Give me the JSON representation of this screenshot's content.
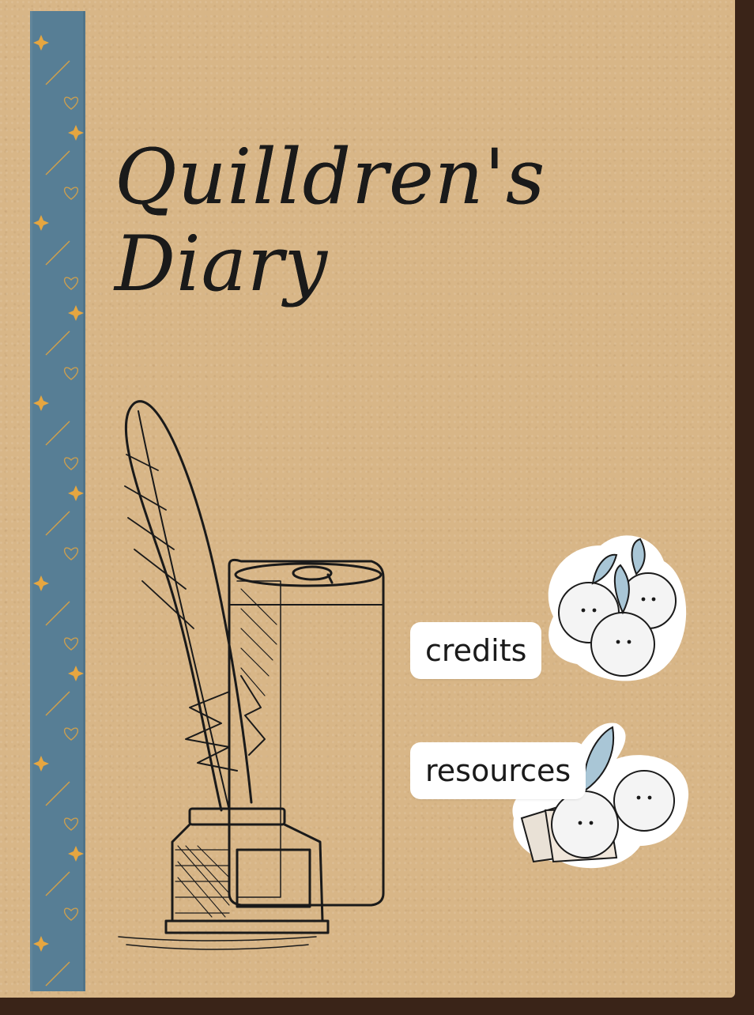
{
  "title": {
    "line1": "Quilldren's",
    "line2": "Diary"
  },
  "menu": {
    "credits_label": "credits",
    "resources_label": "resources"
  },
  "icons": {
    "illustration": "quill-inkwell-can-illustration",
    "credits_sticker": "fluffball-trio-icon",
    "resources_sticker": "fluffball-papers-icon",
    "spine_pattern": "star-heart-pattern"
  },
  "colors": {
    "paper": "#d8b687",
    "spine": "#577e95",
    "frame": "#3a2418",
    "ink": "#1a1a1a",
    "spine_ornament": "#e6a640"
  }
}
